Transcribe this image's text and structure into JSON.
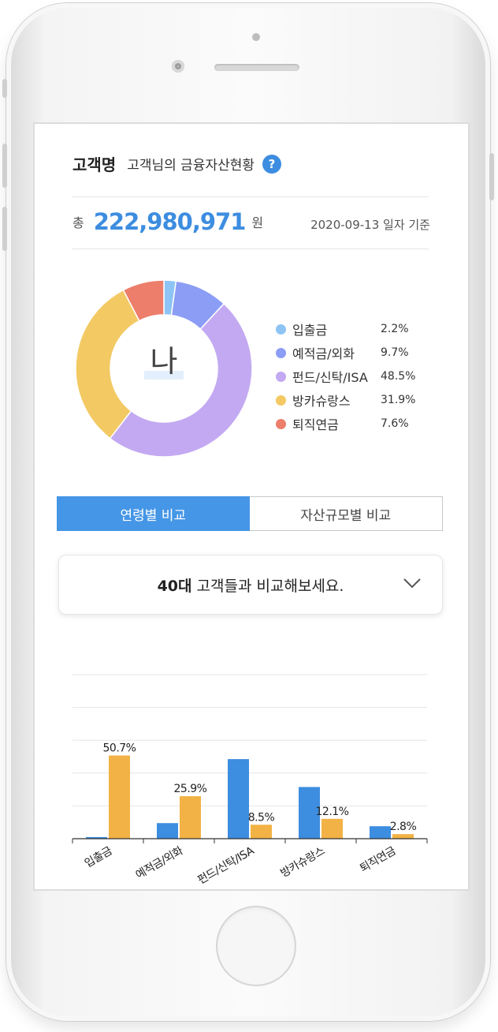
{
  "header": {
    "customer_name": "고객명",
    "subtitle": "고객님의 금융자산현황",
    "help_icon_glyph": "?"
  },
  "summary": {
    "total_prefix": "총",
    "total_amount": "222,980,971",
    "total_unit": "원",
    "as_of": "2020-09-13 일자 기준"
  },
  "donut": {
    "center_text": "나",
    "segments": [
      {
        "label": "입출금",
        "pct_text": "2.2%",
        "value": 2.2,
        "color": "#8ec4f5"
      },
      {
        "label": "예적금/외화",
        "pct_text": "9.7%",
        "value": 9.7,
        "color": "#8b9df5"
      },
      {
        "label": "펀드/신탁/ISA",
        "pct_text": "48.5%",
        "value": 48.5,
        "color": "#c3a9f2"
      },
      {
        "label": "방카슈랑스",
        "pct_text": "31.9%",
        "value": 31.9,
        "color": "#f3c964"
      },
      {
        "label": "퇴직연금",
        "pct_text": "7.6%",
        "value": 7.6,
        "color": "#ec7e6b"
      }
    ]
  },
  "tabs": [
    {
      "label": "연령별 비교",
      "active": true
    },
    {
      "label": "자산규모별 비교",
      "active": false
    }
  ],
  "compare_dropdown": {
    "age_bold": "40대",
    "text": " 고객들과 비교해보세요."
  },
  "chart_data": {
    "type": "bar",
    "categories": [
      "입출금",
      "예적금/외화",
      "펀드/신탁/ISA",
      "방카슈랑스",
      "퇴직연금"
    ],
    "series": [
      {
        "values": [
          1.0,
          9.5,
          48.5,
          31.5,
          7.6
        ],
        "color": "#3d8de0"
      },
      {
        "values": [
          50.7,
          25.9,
          8.5,
          12.1,
          2.8
        ],
        "color": "#f2b245",
        "labels": [
          "50.7%",
          "25.9%",
          "8.5%",
          "12.1%",
          "2.8%"
        ]
      }
    ],
    "ylim": [
      0,
      100
    ],
    "grid": true
  }
}
